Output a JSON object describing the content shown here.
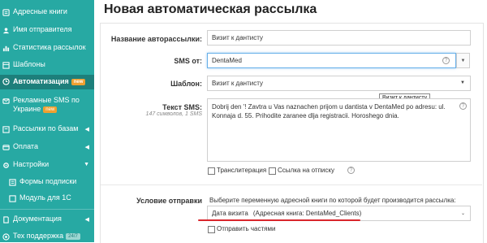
{
  "sidebar": {
    "items": [
      {
        "label": "Адресные книги",
        "icon": "address-book-icon"
      },
      {
        "label": "Имя отправителя",
        "icon": "user-icon"
      },
      {
        "label": "Статистика рассылок",
        "icon": "stats-icon"
      },
      {
        "label": "Шаблоны",
        "icon": "template-icon"
      },
      {
        "label": "Автоматизация",
        "icon": "clock-icon",
        "badge": "new",
        "active": true
      },
      {
        "label": "Рекламные SMS по Украине",
        "icon": "sms-icon",
        "badge": "new"
      },
      {
        "label": "Рассылки по базам",
        "icon": "database-icon"
      },
      {
        "label": "Оплата",
        "icon": "payment-icon"
      },
      {
        "label": "Настройки",
        "icon": "settings-icon"
      },
      {
        "label": "Формы подписки",
        "icon": "form-icon"
      },
      {
        "label": "Модуль для 1С",
        "icon": "module-icon"
      },
      {
        "label": "Документация",
        "icon": "docs-icon"
      },
      {
        "label": "Тех поддержка",
        "icon": "support-icon",
        "badge": "24/7"
      }
    ]
  },
  "page": {
    "title": "Новая автоматическая рассылка"
  },
  "form": {
    "name_label": "Название авторассылки:",
    "name_value": "Визит к дантисту",
    "sms_from_label": "SMS от:",
    "sms_from_value": "DentaMed",
    "template_label": "Шаблон:",
    "template_value": "Визит к дантисту",
    "tooltip": "Визит к дантисту",
    "text_label": "Текст SMS:",
    "text_counter": "147 символов, 1 SMS",
    "text_value": "Dobrij den '! Zavtra u Vas naznachen prijom u dantista v DentaMed po adresu: ul. Konnaja d. 55. Prihodite zaranee dlja registracii. Horoshego dnia.",
    "transliteration_label": "Транслитерация",
    "unsubscribe_label": "Ссылка на отписку",
    "condition_label": "Условие отправки",
    "condition_help": "Выберите переменную адресной книги по которой будет производится рассылка:",
    "condition_value": "Дата визита",
    "condition_book": "(Адресная книга: DentaMed_Clients)",
    "send_parts_label": "Отправить частями"
  },
  "colors": {
    "sidebar_bg": "#27a9a3",
    "sidebar_active": "#1d7f7b",
    "badge_new": "#f0a030",
    "underline": "#d9262c"
  }
}
